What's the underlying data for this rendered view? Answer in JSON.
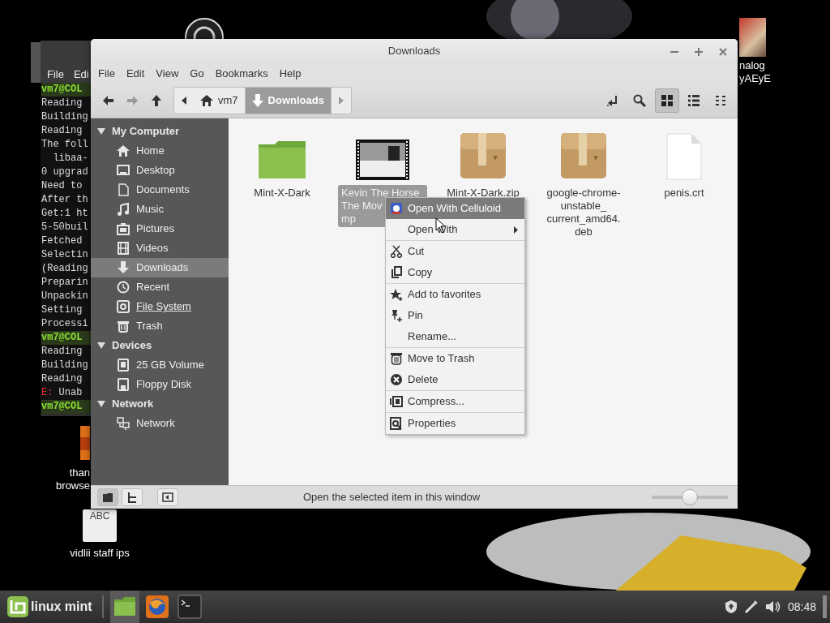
{
  "desktop_icons": [
    {
      "kind": "disc"
    },
    {
      "kind": "picture",
      "lines": [
        "nalog",
        "yAEyE"
      ]
    },
    {
      "kind": "app",
      "lines": [
        "than",
        "browse"
      ]
    },
    {
      "kind": "document",
      "icon_text": "ABC",
      "lines": [
        "vidlii staff ips"
      ]
    }
  ],
  "terminal": {
    "menu": [
      "File",
      "Edi"
    ],
    "lines": [
      {
        "kind": "prompt",
        "text": "vm7@COL"
      },
      {
        "kind": "output",
        "text": "Reading"
      },
      {
        "kind": "output",
        "text": "Building"
      },
      {
        "kind": "output",
        "text": "Reading"
      },
      {
        "kind": "output",
        "text": "The foll"
      },
      {
        "kind": "output",
        "text": "  libaa-"
      },
      {
        "kind": "output",
        "text": "0 upgrad"
      },
      {
        "kind": "output",
        "text": "Need to"
      },
      {
        "kind": "output",
        "text": "After th"
      },
      {
        "kind": "output",
        "text": "Get:1 ht"
      },
      {
        "kind": "output",
        "text": "5-50buil"
      },
      {
        "kind": "output",
        "text": "Fetched"
      },
      {
        "kind": "output",
        "text": "Selectin"
      },
      {
        "kind": "output",
        "text": "(Reading"
      },
      {
        "kind": "output",
        "text": "Preparin"
      },
      {
        "kind": "output",
        "text": "Unpackin"
      },
      {
        "kind": "output",
        "text": "Setting"
      },
      {
        "kind": "output",
        "text": "Processi"
      },
      {
        "kind": "prompt",
        "text": "vm7@COL"
      },
      {
        "kind": "output",
        "text": "Reading"
      },
      {
        "kind": "output",
        "text": "Building"
      },
      {
        "kind": "output",
        "text": "Reading"
      },
      {
        "kind": "error",
        "prefix": "E:",
        "text": "Unab"
      },
      {
        "kind": "prompt",
        "text": "vm7@COL"
      }
    ]
  },
  "file_manager": {
    "title": "Downloads",
    "menu": [
      "File",
      "Edit",
      "View",
      "Go",
      "Bookmarks",
      "Help"
    ],
    "breadcrumb": [
      {
        "label": "vm7",
        "selected": false
      },
      {
        "label": "Downloads",
        "selected": true
      }
    ],
    "view_buttons": [
      {
        "selected": true
      },
      {
        "selected": false
      },
      {
        "selected": false
      }
    ],
    "sidebar": [
      {
        "heading": "My Computer",
        "expanded": true,
        "items": [
          {
            "label": "Home",
            "selected": false,
            "hover": false
          },
          {
            "label": "Desktop",
            "selected": false,
            "hover": false
          },
          {
            "label": "Documents",
            "selected": false,
            "hover": false
          },
          {
            "label": "Music",
            "selected": false,
            "hover": false
          },
          {
            "label": "Pictures",
            "selected": false,
            "hover": false
          },
          {
            "label": "Videos",
            "selected": false,
            "hover": false
          },
          {
            "label": "Downloads",
            "selected": true,
            "hover": false
          },
          {
            "label": "Recent",
            "selected": false,
            "hover": false
          },
          {
            "label": "File System",
            "selected": false,
            "hover": true
          },
          {
            "label": "Trash",
            "selected": false,
            "hover": false
          }
        ]
      },
      {
        "heading": "Devices",
        "expanded": true,
        "items": [
          {
            "label": "25 GB Volume",
            "selected": false,
            "hover": false
          },
          {
            "label": "Floppy Disk",
            "selected": false,
            "hover": false
          }
        ]
      },
      {
        "heading": "Network",
        "expanded": true,
        "items": [
          {
            "label": "Network",
            "selected": false,
            "hover": false
          }
        ]
      }
    ],
    "files": [
      {
        "kind": "folder",
        "selected": false,
        "lines": [
          "Mint-X-Dark"
        ]
      },
      {
        "kind": "video",
        "selected": true,
        "lines": [
          "Kevin The Horse",
          "The Mov",
          "mp"
        ]
      },
      {
        "kind": "archive",
        "selected": false,
        "lines": [
          "Mint-X-Dark.zip"
        ]
      },
      {
        "kind": "archive",
        "selected": false,
        "lines": [
          "google-chrome-",
          "unstable_",
          "current_amd64.",
          "deb"
        ]
      },
      {
        "kind": "file",
        "selected": false,
        "lines": [
          "penis.crt"
        ]
      }
    ],
    "context_menu": {
      "groups": [
        [
          {
            "label": "Open With Celluloid",
            "selected": true,
            "submenu": false
          },
          {
            "label": "Open With",
            "selected": false,
            "submenu": true
          }
        ],
        [
          {
            "label": "Cut",
            "selected": false,
            "submenu": false
          },
          {
            "label": "Copy",
            "selected": false,
            "submenu": false
          }
        ],
        [
          {
            "label": "Add to favorites",
            "selected": false,
            "submenu": false
          },
          {
            "label": "Pin",
            "selected": false,
            "submenu": false
          },
          {
            "label": "Rename...",
            "selected": false,
            "submenu": false
          }
        ],
        [
          {
            "label": "Move to Trash",
            "selected": false,
            "submenu": false
          },
          {
            "label": "Delete",
            "selected": false,
            "submenu": false
          }
        ],
        [
          {
            "label": "Compress...",
            "selected": false,
            "submenu": false
          }
        ],
        [
          {
            "label": "Properties",
            "selected": false,
            "submenu": false
          }
        ]
      ]
    },
    "status_bar": {
      "pane_buttons": [
        {
          "selected": true
        },
        {
          "selected": false
        },
        {
          "selected": false
        }
      ],
      "text": "Open the selected item in this window",
      "zoom": {
        "level": 0.5
      }
    }
  },
  "taskbar": {
    "menu_label": "linux mint",
    "launchers": [
      {
        "kind": "files",
        "selected": true
      },
      {
        "kind": "browser",
        "selected": false
      },
      {
        "kind": "terminal",
        "selected": false
      }
    ],
    "clock": "08:48"
  }
}
